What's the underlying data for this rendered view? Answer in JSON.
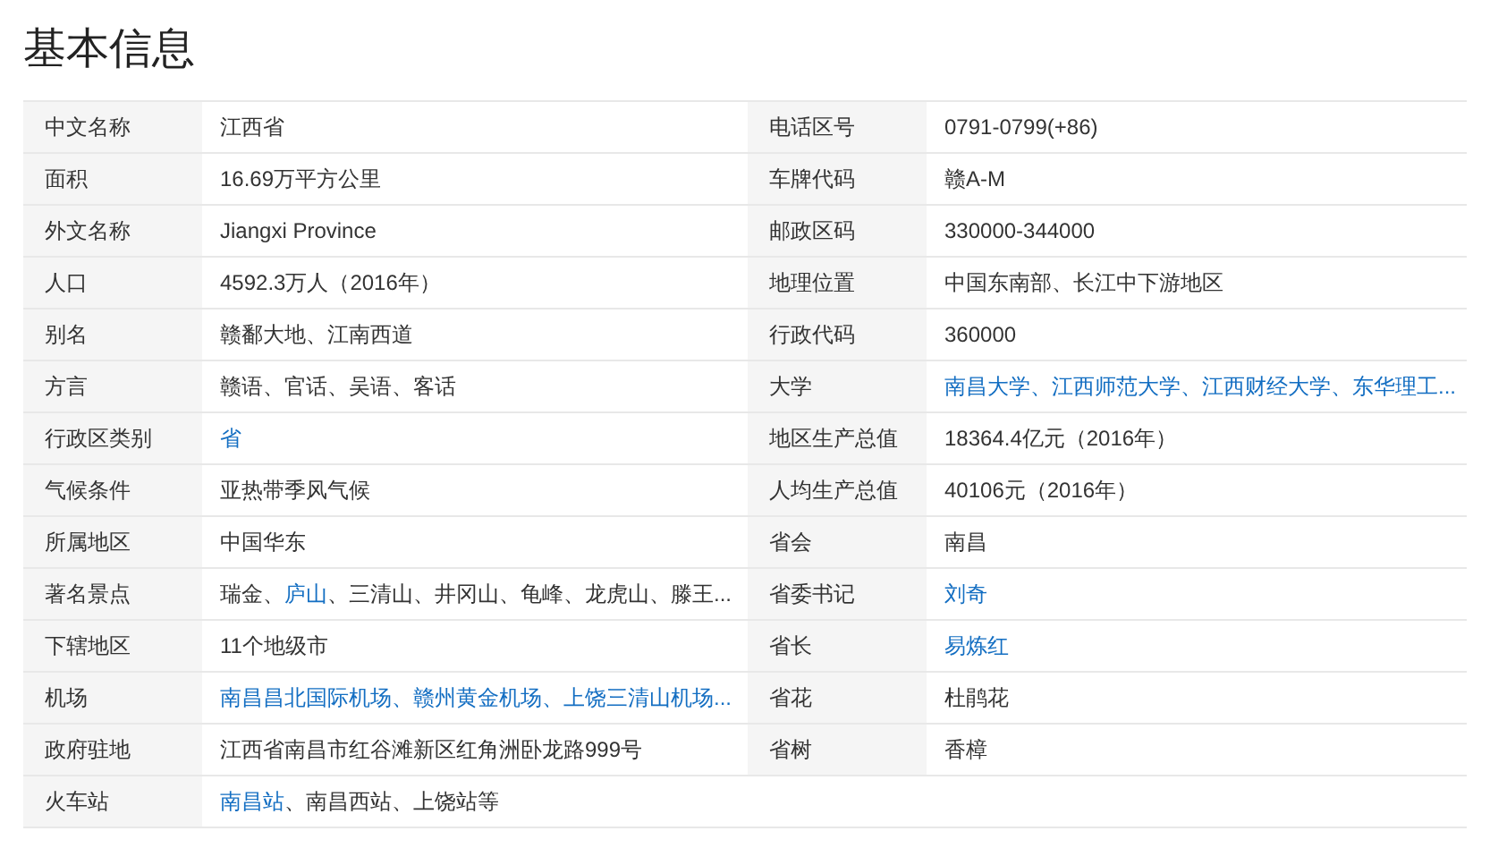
{
  "title": "基本信息",
  "rows": [
    {
      "left": {
        "label": "中文名称",
        "value": [
          {
            "text": "江西省",
            "link": false
          }
        ]
      },
      "right": {
        "label": "电话区号",
        "value": [
          {
            "text": "0791-0799(+86)",
            "link": false
          }
        ]
      }
    },
    {
      "left": {
        "label": "面积",
        "value": [
          {
            "text": "16.69万平方公里",
            "link": false
          }
        ]
      },
      "right": {
        "label": "车牌代码",
        "value": [
          {
            "text": "赣A-M",
            "link": false
          }
        ]
      }
    },
    {
      "left": {
        "label": "外文名称",
        "value": [
          {
            "text": "Jiangxi Province",
            "link": false
          }
        ]
      },
      "right": {
        "label": "邮政区码",
        "value": [
          {
            "text": "330000-344000",
            "link": false
          }
        ]
      }
    },
    {
      "left": {
        "label": "人口",
        "value": [
          {
            "text": "4592.3万人（2016年）",
            "link": false
          }
        ]
      },
      "right": {
        "label": "地理位置",
        "value": [
          {
            "text": "中国东南部、长江中下游地区",
            "link": false
          }
        ]
      }
    },
    {
      "left": {
        "label": "别名",
        "value": [
          {
            "text": "赣鄱大地、江南西道",
            "link": false
          }
        ]
      },
      "right": {
        "label": "行政代码",
        "value": [
          {
            "text": "360000",
            "link": false
          }
        ]
      }
    },
    {
      "left": {
        "label": "方言",
        "value": [
          {
            "text": "赣语、官话、吴语、客话",
            "link": false
          }
        ]
      },
      "right": {
        "label": "大学",
        "value": [
          {
            "text": "南昌大学、江西师范大学、江西财经大学、东华理工...",
            "link": true
          }
        ]
      }
    },
    {
      "left": {
        "label": "行政区类别",
        "value": [
          {
            "text": "省",
            "link": true
          }
        ]
      },
      "right": {
        "label": "地区生产总值",
        "value": [
          {
            "text": "18364.4亿元（2016年）",
            "link": false
          }
        ]
      }
    },
    {
      "left": {
        "label": "气候条件",
        "value": [
          {
            "text": "亚热带季风气候",
            "link": false
          }
        ]
      },
      "right": {
        "label": "人均生产总值",
        "value": [
          {
            "text": "40106元（2016年）",
            "link": false
          }
        ]
      }
    },
    {
      "left": {
        "label": "所属地区",
        "value": [
          {
            "text": "中国华东",
            "link": false
          }
        ]
      },
      "right": {
        "label": "省会",
        "value": [
          {
            "text": "南昌",
            "link": false
          }
        ]
      }
    },
    {
      "left": {
        "label": "著名景点",
        "value": [
          {
            "text": "瑞金、",
            "link": false
          },
          {
            "text": "庐山",
            "link": true
          },
          {
            "text": "、三清山、井冈山、龟峰、龙虎山、滕王...",
            "link": false
          }
        ]
      },
      "right": {
        "label": "省委书记",
        "value": [
          {
            "text": "刘奇",
            "link": true
          }
        ]
      }
    },
    {
      "left": {
        "label": "下辖地区",
        "value": [
          {
            "text": "11个地级市",
            "link": false
          }
        ]
      },
      "right": {
        "label": "省长",
        "value": [
          {
            "text": "易炼红",
            "link": true
          }
        ]
      }
    },
    {
      "left": {
        "label": "机场",
        "value": [
          {
            "text": "南昌昌北国际机场、赣州黄金机场、上饶三清山机场...",
            "link": true
          }
        ]
      },
      "right": {
        "label": "省花",
        "value": [
          {
            "text": "杜鹃花",
            "link": false
          }
        ]
      }
    },
    {
      "left": {
        "label": "政府驻地",
        "value": [
          {
            "text": "江西省南昌市红谷滩新区红角洲卧龙路999号",
            "link": false
          }
        ]
      },
      "right": {
        "label": "省树",
        "value": [
          {
            "text": "香樟",
            "link": false
          }
        ]
      }
    },
    {
      "left": {
        "label": "火车站",
        "value": [
          {
            "text": "南昌站",
            "link": true
          },
          {
            "text": "、南昌西站、上饶站等",
            "link": false
          }
        ]
      }
    }
  ]
}
